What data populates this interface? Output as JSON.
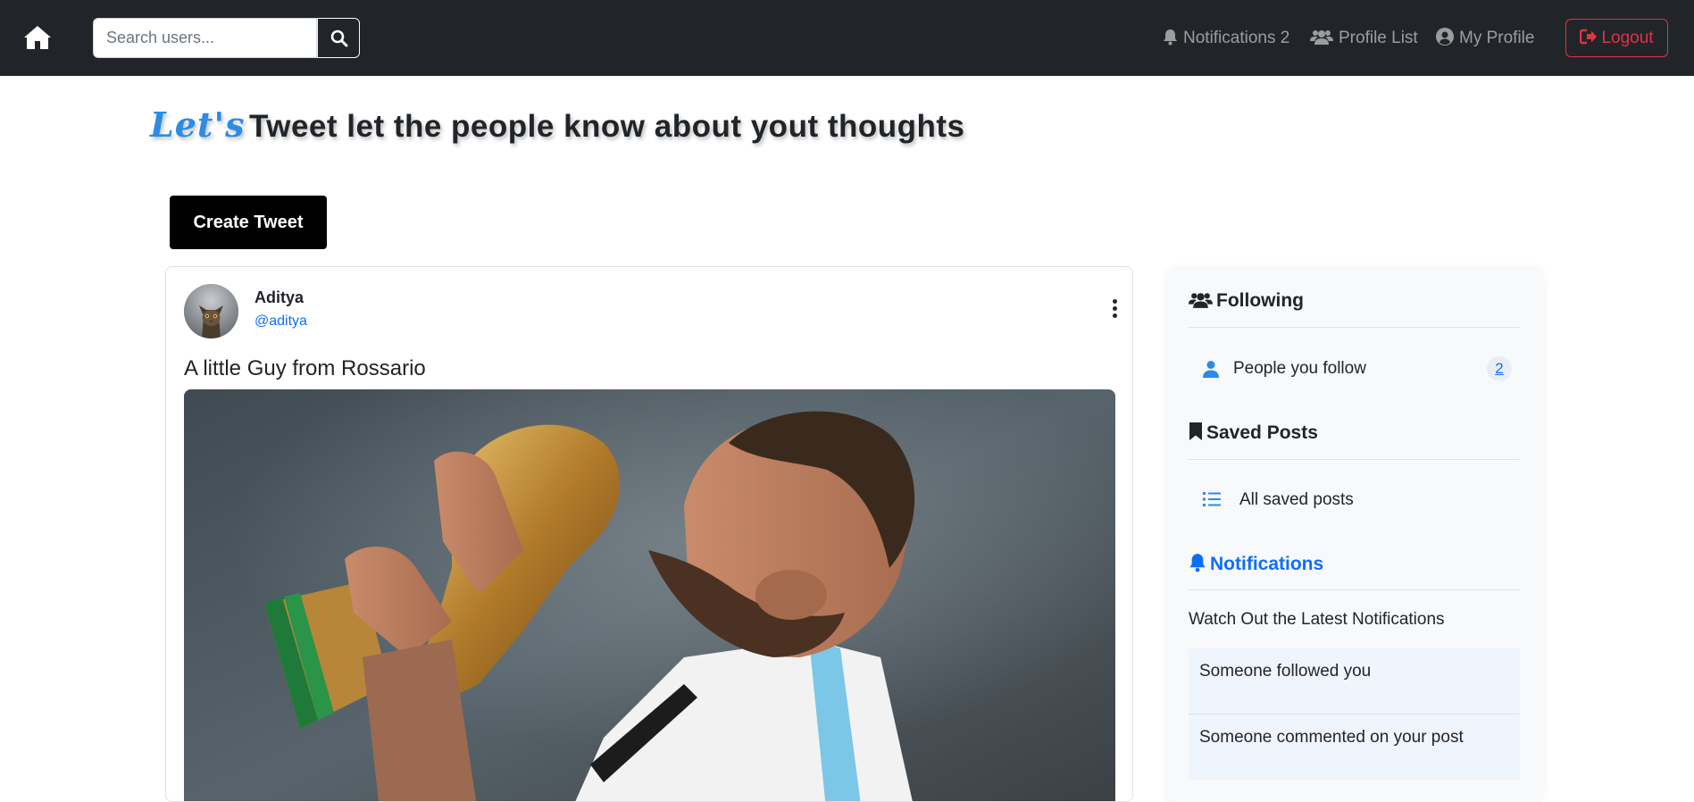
{
  "nav": {
    "search_placeholder": "Search users...",
    "notifications_label": "Notifications 2",
    "profile_list_label": "Profile List",
    "my_profile_label": "My Profile",
    "logout_label": "Logout"
  },
  "headline": {
    "lets": "Let's",
    "rest": "Tweet let the people know about yout thoughts"
  },
  "create_tweet_label": "Create Tweet",
  "tweet": {
    "author_name": "Aditya",
    "author_handle": "@aditya",
    "text": "A little Guy from Rossario"
  },
  "sidebar": {
    "following": {
      "title": "Following",
      "item_label": "People you follow",
      "count": "2"
    },
    "saved": {
      "title": "Saved Posts",
      "item_label": "All saved posts"
    },
    "notifications": {
      "title": "Notifications",
      "subtitle": "Watch Out the Latest Notifications",
      "items": [
        "Someone followed you",
        "Someone commented on your post"
      ]
    }
  },
  "colors": {
    "navbar": "#212529",
    "accent": "#0d6efd",
    "danger": "#dc3545",
    "lets": "#2b8be5"
  }
}
